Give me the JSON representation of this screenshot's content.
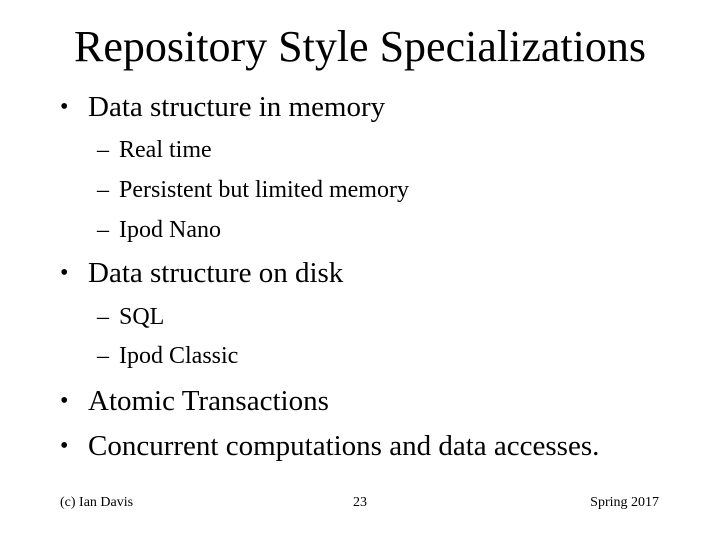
{
  "slide": {
    "title": "Repository Style Specializations",
    "bullet_marker": "•",
    "sub_marker": "–",
    "bullets": [
      {
        "text": "Data structure in memory",
        "subitems": [
          "Real time",
          "Persistent but limited memory",
          "Ipod Nano"
        ]
      },
      {
        "text": "Data structure on disk",
        "subitems": [
          "SQL",
          "Ipod Classic"
        ]
      },
      {
        "text": "Atomic Transactions",
        "subitems": []
      },
      {
        "text": "Concurrent computations and data accesses.",
        "subitems": []
      }
    ],
    "footer": {
      "left": "(c) Ian Davis",
      "center": "23",
      "right": "Spring 2017"
    }
  }
}
